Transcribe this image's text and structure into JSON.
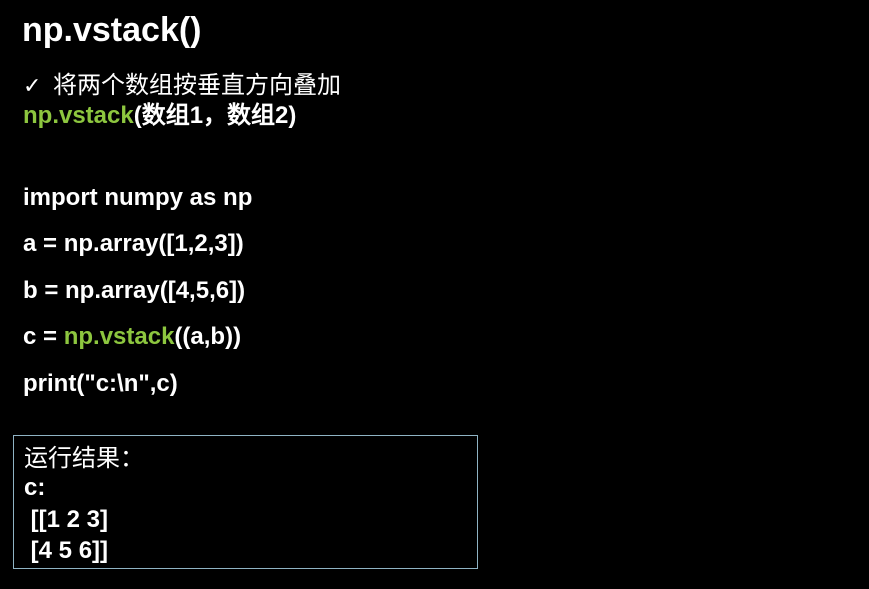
{
  "title": "np.vstack()",
  "bullet": {
    "mark": "✓",
    "text": "将两个数组按垂直方向叠加"
  },
  "syntax": {
    "func": "np.vstack",
    "args": "(数组1，数组2)"
  },
  "code": {
    "line1": "import numpy as np",
    "line2": "a = np.array([1,2,3])",
    "line3": "b = np.array([4,5,6])",
    "line4_prefix": "c = ",
    "line4_func": "np.vstack",
    "line4_suffix": "((a,b))",
    "line5": "print(\"c:\\n\",c)"
  },
  "result": {
    "heading": "运行结果：",
    "lines": [
      "c:",
      " [[1 2 3]",
      " [4 5 6]]"
    ]
  },
  "colors": {
    "background": "#000000",
    "text": "#ffffff",
    "accent": "#8dc63f",
    "box_border": "#8fb3c4"
  }
}
